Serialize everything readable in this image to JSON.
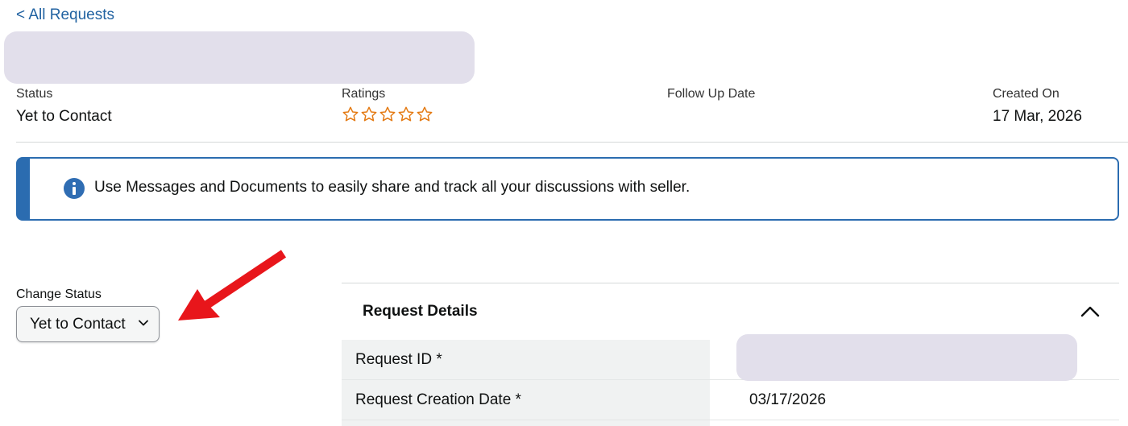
{
  "nav": {
    "back_label": "< All Requests"
  },
  "summary": {
    "status": {
      "label": "Status",
      "value": "Yet to Contact"
    },
    "ratings": {
      "label": "Ratings",
      "stars_filled": 0,
      "stars_total": 5
    },
    "follow_up": {
      "label": "Follow Up Date",
      "value": ""
    },
    "created": {
      "label": "Created On",
      "value": "17 Mar, 2026"
    }
  },
  "info_banner": {
    "text": "Use Messages and Documents to easily share and track all your discussions with seller."
  },
  "change_status": {
    "label": "Change Status",
    "selected": "Yet to Contact"
  },
  "request_details": {
    "title": "Request Details",
    "rows": [
      {
        "key": "Request ID *",
        "value": ""
      },
      {
        "key": "Request Creation Date *",
        "value": "03/17/2026"
      }
    ]
  },
  "colors": {
    "link": "#2162a1",
    "info_accent": "#2b6cb0",
    "star": "#e47911",
    "arrow": "#e8161b",
    "redaction": "#e2dfeb"
  }
}
